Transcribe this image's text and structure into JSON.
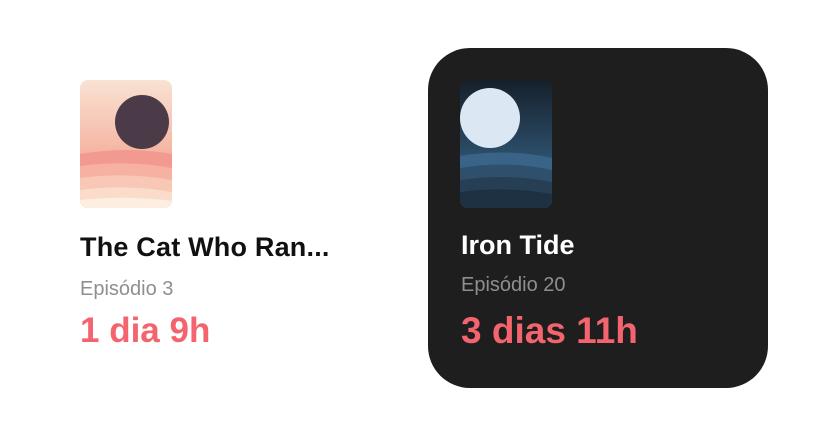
{
  "widgets": [
    {
      "theme": "light",
      "title": "The Cat Who Ran...",
      "episode": "Episódio 3",
      "countdown": "1 dia 9h",
      "cover_icon": "sunset-artwork"
    },
    {
      "theme": "dark",
      "title": "Iron Tide",
      "episode": "Episódio 20",
      "countdown": "3 dias 11h",
      "cover_icon": "moonlit-sea-artwork"
    }
  ],
  "colors": {
    "accent": "#f4646e",
    "dark_widget_bg": "#1e1e1e",
    "secondary_text": "#8e8e93"
  }
}
